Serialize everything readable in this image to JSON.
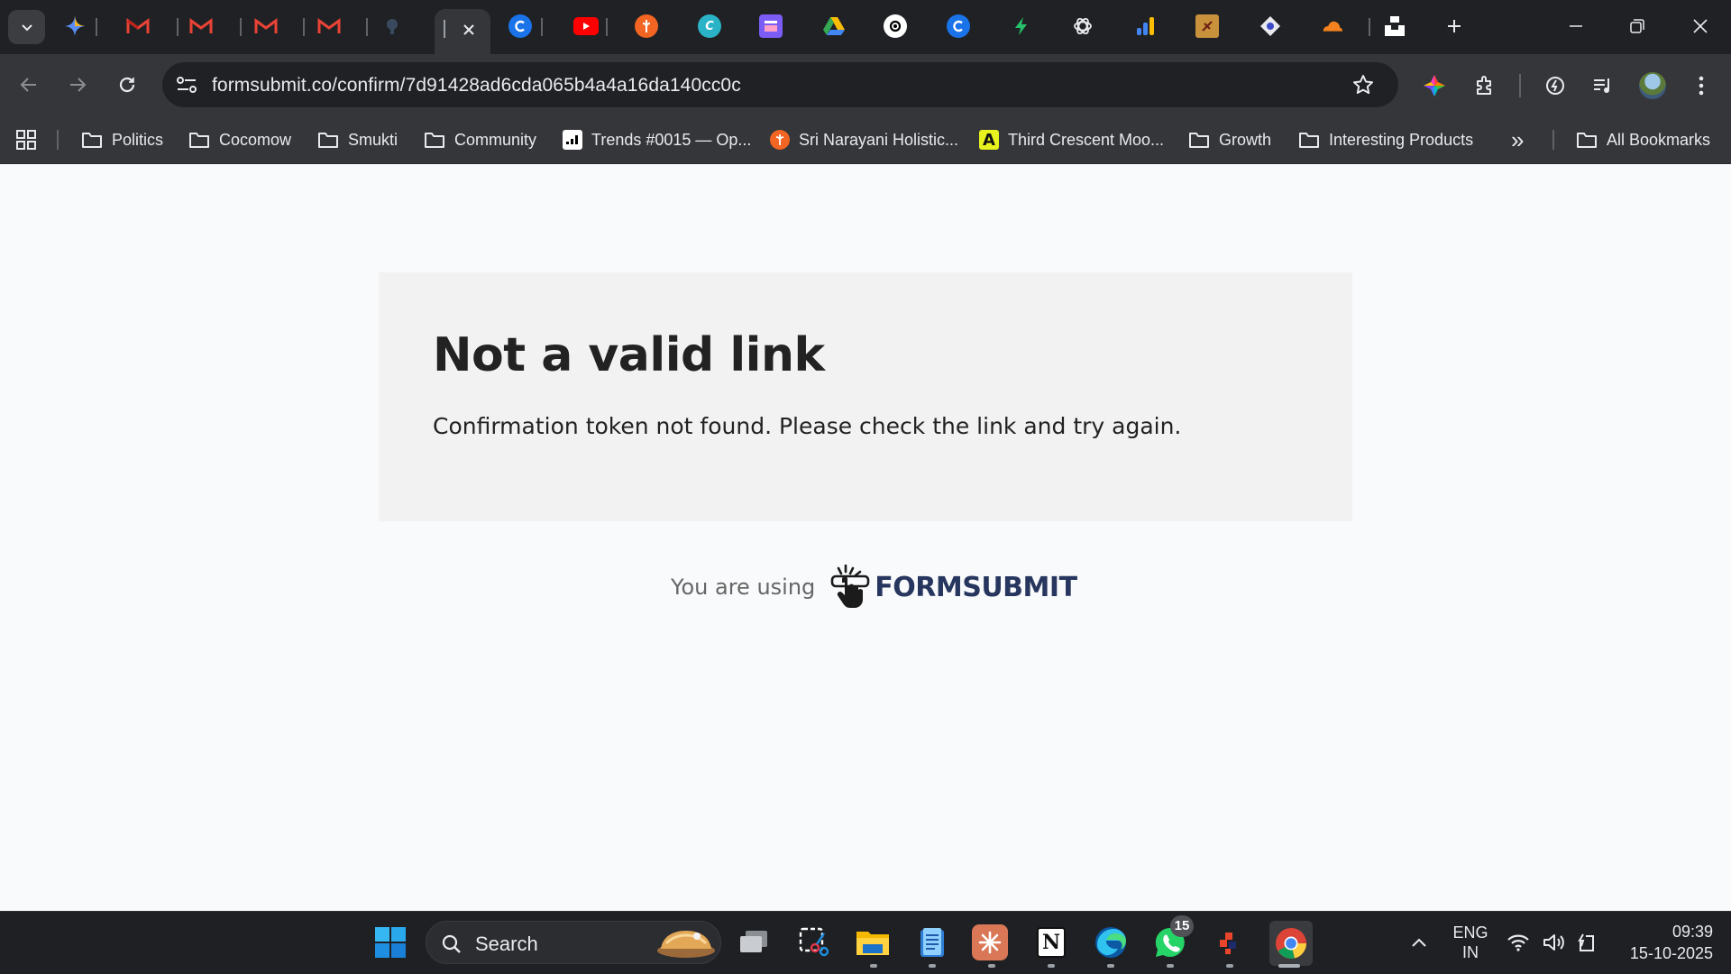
{
  "browser": {
    "address_url": "formsubmit.co/confirm/7d91428ad6cda065b4a4a16da140cc0c",
    "active_tab_title": ""
  },
  "bookmarks": [
    {
      "label": "Politics",
      "icon": "folder-icon"
    },
    {
      "label": "Cocomow",
      "icon": "folder-icon"
    },
    {
      "label": "Smukti",
      "icon": "folder-icon"
    },
    {
      "label": "Community",
      "icon": "folder-icon"
    },
    {
      "label": "Trends #0015 — Op...",
      "icon": "trends-icon"
    },
    {
      "label": "Sri Narayani Holistic...",
      "icon": "narayani-icon"
    },
    {
      "label": "Third Crescent Moo...",
      "icon": "crescent-icon"
    },
    {
      "label": "Growth",
      "icon": "folder-icon"
    },
    {
      "label": "Interesting Products",
      "icon": "folder-icon"
    }
  ],
  "bookmarks_more": "»",
  "all_bookmarks": "All Bookmarks",
  "page": {
    "title": "Not a valid link",
    "message": "Confirmation token not found. Please check the link and try again.",
    "footer_prefix": "You are using",
    "brand_name": "FORMSUBMIT"
  },
  "taskbar": {
    "search_label": "Search",
    "language_line1": "ENG",
    "language_line2": "IN",
    "time": "09:39",
    "date": "15-10-2025",
    "whatsapp_badge": "15"
  },
  "colors": {
    "brand_navy": "#27365e",
    "card_bg": "#f2f2f2",
    "page_bg": "#f9fafb",
    "chrome_dark": "#202124",
    "chrome_toolbar": "#35363a"
  }
}
